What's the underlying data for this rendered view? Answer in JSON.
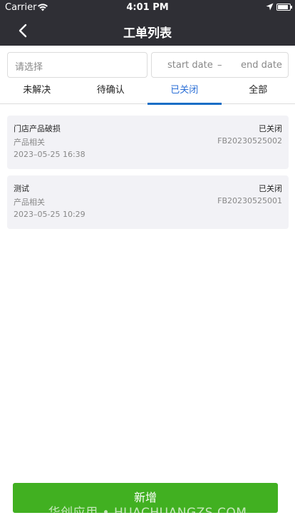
{
  "status_bar": {
    "carrier": "Carrier",
    "time": "4:01 PM",
    "battery_level": 0.9
  },
  "nav": {
    "title": "工单列表"
  },
  "filter": {
    "select_placeholder": "请选择",
    "start_date_placeholder": "start date",
    "separator": "–",
    "end_date_placeholder": "end date"
  },
  "tabs": [
    {
      "label": "未解决",
      "active": false
    },
    {
      "label": "待确认",
      "active": false
    },
    {
      "label": "已关闭",
      "active": true
    },
    {
      "label": "全部",
      "active": false
    }
  ],
  "tickets": [
    {
      "name": "门店产品破损",
      "status": "已关闭",
      "category": "产品相关",
      "code": "FB20230525002",
      "time": "2023–05-25 16:38"
    },
    {
      "name": "测试",
      "status": "已关闭",
      "category": "产品相关",
      "code": "FB20230525001",
      "time": "2023–05-25 10:29"
    }
  ],
  "add_button": {
    "label": "新增"
  },
  "watermark": "华创应用 • HUACHUANGZS.COM",
  "colors": {
    "nav_bg": "#2f2f35",
    "active_tab": "#1a6ec6",
    "primary_button": "#41b021"
  }
}
